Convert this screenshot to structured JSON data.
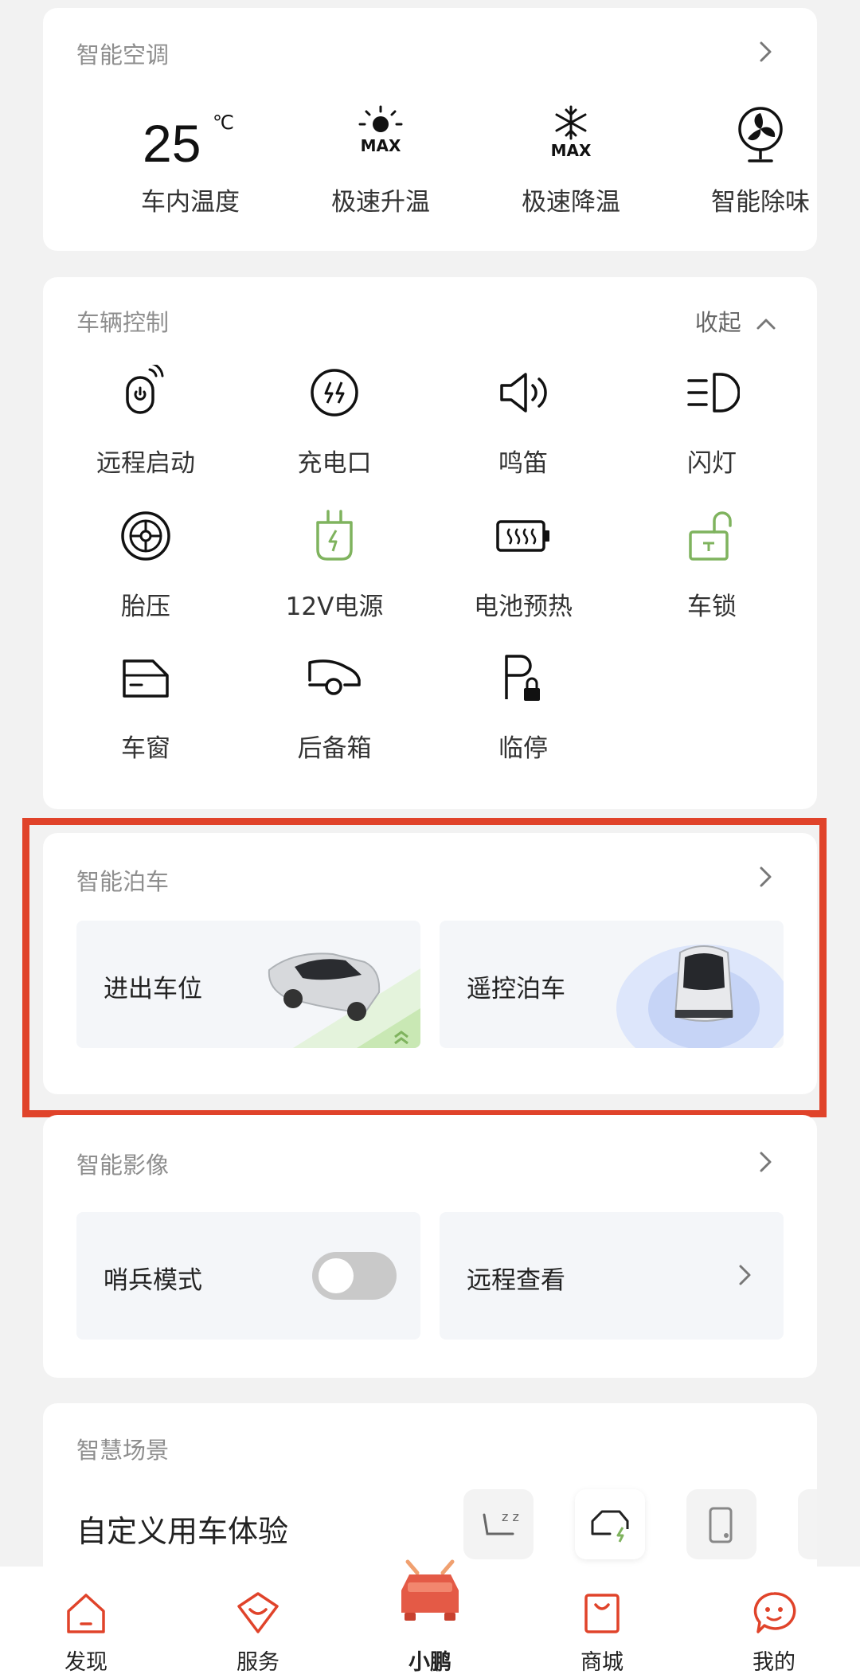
{
  "colors": {
    "accent": "#e0432a",
    "green": "#7fb35e",
    "text": "#222222",
    "muted": "#8e8e8e",
    "background": "#f2f2f2"
  },
  "ac": {
    "title": "智能空调",
    "temperature": "25",
    "temperature_unit": "℃",
    "items": [
      {
        "label": "车内温度",
        "icon": "temperature-readout"
      },
      {
        "label": "极速升温",
        "icon": "sun-max-icon"
      },
      {
        "label": "极速降温",
        "icon": "snowflake-max-icon"
      },
      {
        "label": "智能除味",
        "icon": "fan-icon"
      }
    ]
  },
  "vehicle_control": {
    "title": "车辆控制",
    "collapse_label": "收起",
    "items": [
      {
        "label": "远程启动",
        "icon": "remote-start-icon"
      },
      {
        "label": "充电口",
        "icon": "charge-port-icon"
      },
      {
        "label": "鸣笛",
        "icon": "horn-icon"
      },
      {
        "label": "闪灯",
        "icon": "headlight-icon"
      },
      {
        "label": "胎压",
        "icon": "tire-icon"
      },
      {
        "label": "12V电源",
        "icon": "plug-icon"
      },
      {
        "label": "电池预热",
        "icon": "battery-heat-icon"
      },
      {
        "label": "车锁",
        "icon": "unlock-icon"
      },
      {
        "label": "车窗",
        "icon": "window-icon"
      },
      {
        "label": "后备箱",
        "icon": "trunk-icon"
      },
      {
        "label": "临停",
        "icon": "parking-lock-icon"
      }
    ]
  },
  "parking": {
    "title": "智能泊车",
    "tiles": [
      {
        "label": "进出车位"
      },
      {
        "label": "遥控泊车"
      }
    ]
  },
  "camera": {
    "title": "智能影像",
    "sentry_label": "哨兵模式",
    "sentry_enabled": false,
    "remote_view_label": "远程查看"
  },
  "scene": {
    "title": "智慧场景",
    "subtitle": "自定义用车体验",
    "icons": [
      "sleep-seat-icon",
      "car-charge-icon",
      "phone-icon"
    ]
  },
  "tabbar": {
    "items": [
      {
        "label": "发现",
        "icon": "home-icon"
      },
      {
        "label": "服务",
        "icon": "service-icon"
      },
      {
        "label": "小鹏",
        "icon": "car-logo-icon"
      },
      {
        "label": "商城",
        "icon": "shop-bag-icon"
      },
      {
        "label": "我的",
        "icon": "profile-face-icon"
      }
    ]
  }
}
